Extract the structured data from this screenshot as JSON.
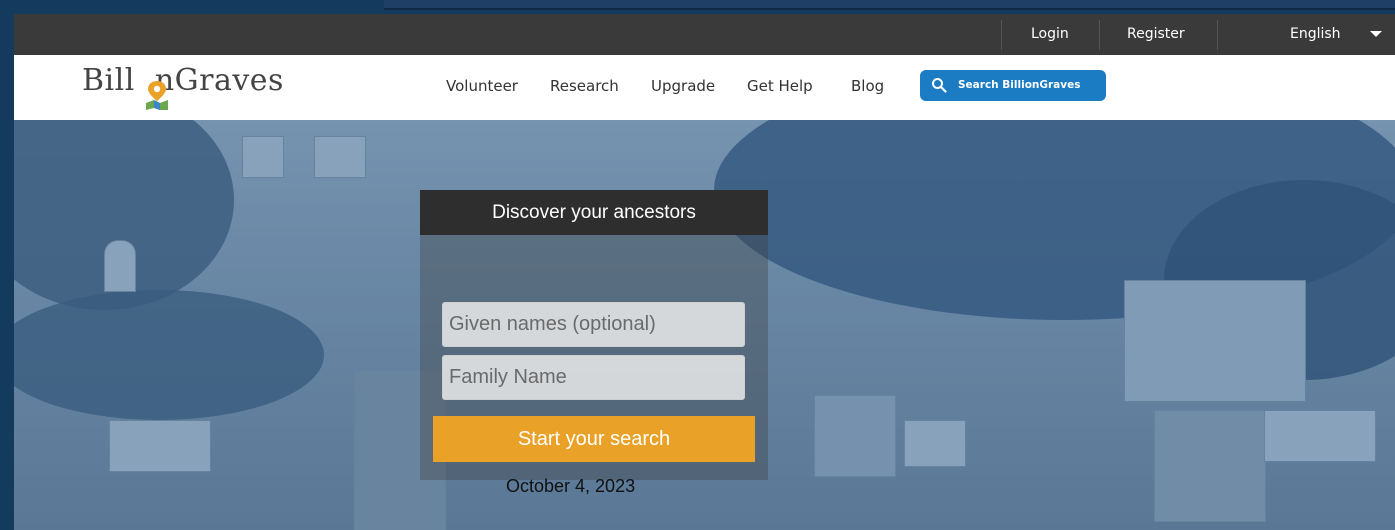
{
  "topbar": {
    "login": "Login",
    "register": "Register",
    "language": "English"
  },
  "brand": {
    "name": "BillionGraves",
    "part1": "Bill",
    "part2": "nGraves"
  },
  "nav": {
    "items": [
      "Volunteer",
      "Research",
      "Upgrade",
      "Get Help",
      "Blog"
    ],
    "search_label": "Search BillionGraves"
  },
  "hero": {
    "heading": "Discover your ancestors",
    "given_placeholder": "Given names (optional)",
    "family_placeholder": "Family Name",
    "submit_label": "Start your search",
    "date": "October 4, 2023"
  },
  "colors": {
    "accent_orange": "#e9a128",
    "search_blue": "#1b7cc4",
    "topbar": "#3a3a3a"
  }
}
